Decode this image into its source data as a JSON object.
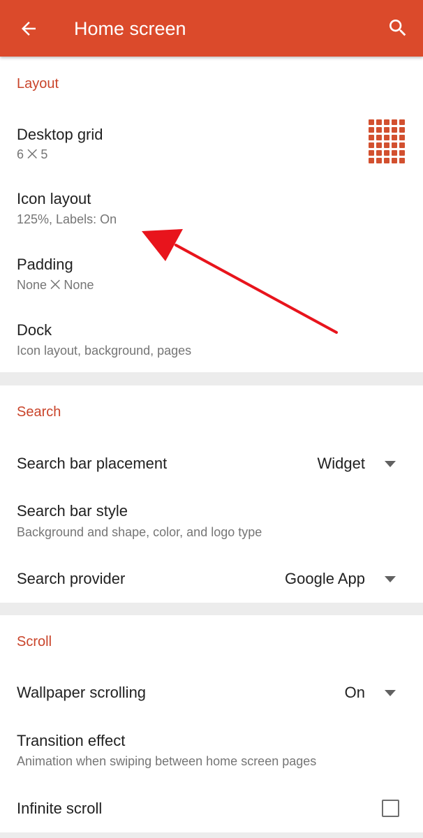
{
  "appbar": {
    "title": "Home screen",
    "back_icon": "arrow-back-icon",
    "search_icon": "search-icon",
    "color": "#db4a2b"
  },
  "layout": {
    "header": "Layout",
    "desktop_grid": {
      "title": "Desktop grid",
      "subtitle": "6 ⨉ 5",
      "icon": "grid-icon"
    },
    "icon_layout": {
      "title": "Icon layout",
      "subtitle": "125%, Labels: On"
    },
    "padding": {
      "title": "Padding",
      "subtitle": "None ⨉ None"
    },
    "dock": {
      "title": "Dock",
      "subtitle": "Icon layout, background, pages"
    }
  },
  "search": {
    "header": "Search",
    "bar_placement": {
      "title": "Search bar placement",
      "value": "Widget"
    },
    "bar_style": {
      "title": "Search bar style",
      "subtitle": "Background and shape, color, and logo type"
    },
    "provider": {
      "title": "Search provider",
      "value": "Google App"
    }
  },
  "scroll": {
    "header": "Scroll",
    "wallpaper": {
      "title": "Wallpaper scrolling",
      "value": "On"
    },
    "transition": {
      "title": "Transition effect",
      "subtitle": "Animation when swiping between home screen pages"
    },
    "infinite": {
      "title": "Infinite scroll",
      "checked": false
    }
  },
  "colors": {
    "accent": "#c9442a",
    "annotation_arrow": "#e8141c"
  }
}
